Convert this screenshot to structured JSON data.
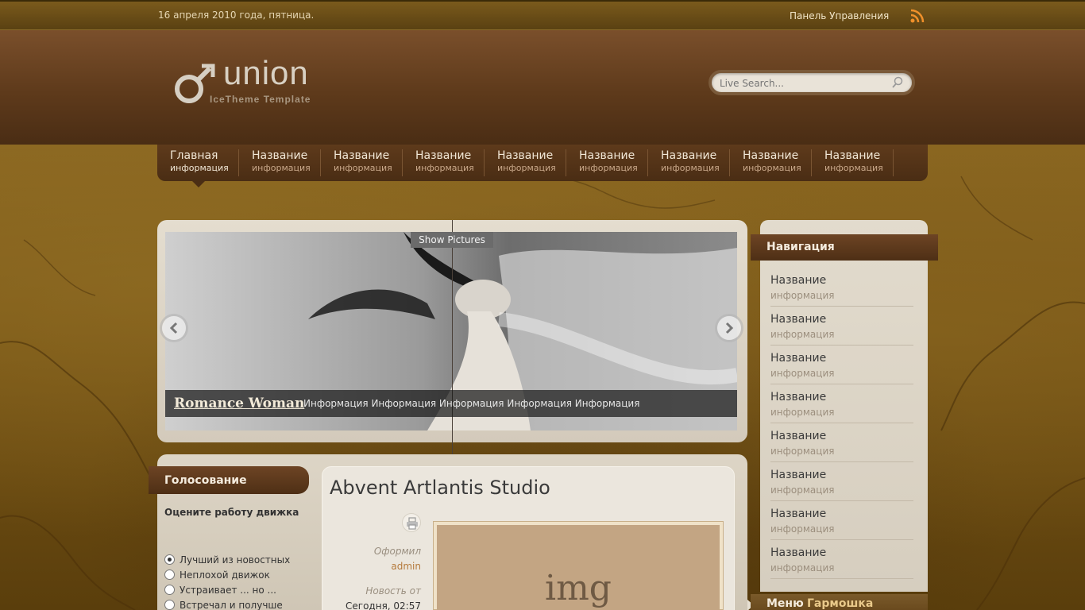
{
  "topbar": {
    "date": "16 апреля 2010 года, пятница.",
    "panel_label": "Панель Управления",
    "rss_icon": "rss-icon"
  },
  "header": {
    "logo_text": "union",
    "logo_sub": "IceTheme Template",
    "search_placeholder": "Live Search..."
  },
  "nav": {
    "items": [
      {
        "title": "Главная",
        "sub": "информация"
      },
      {
        "title": "Название",
        "sub": "информация"
      },
      {
        "title": "Название",
        "sub": "информация"
      },
      {
        "title": "Название",
        "sub": "информация"
      },
      {
        "title": "Название",
        "sub": "информация"
      },
      {
        "title": "Название",
        "sub": "информация"
      },
      {
        "title": "Название",
        "sub": "информация"
      },
      {
        "title": "Название",
        "sub": "информация"
      },
      {
        "title": "Название",
        "sub": "информация"
      }
    ]
  },
  "slideshow": {
    "show_pictures": "Show Pictures",
    "caption_title": "Romance Woman",
    "caption_desc": "Информация Информация Информация Информация Информация"
  },
  "poll": {
    "title": "Голосование",
    "question": "Оцените работу движка",
    "options": [
      "Лучший из новостных",
      "Неплохой движок",
      "Устраивает ... но ...",
      "Встречал и получше"
    ]
  },
  "article": {
    "title": "Abvent Artlantis Studio",
    "author_label": "Оформил",
    "author": "admin",
    "date_label": "Новость от",
    "date": "Сегодня, 02:57",
    "image_label": "img"
  },
  "sidebar": {
    "title": "Навигация",
    "items": [
      {
        "title": "Название",
        "sub": "информация"
      },
      {
        "title": "Название",
        "sub": "информация"
      },
      {
        "title": "Название",
        "sub": "информация"
      },
      {
        "title": "Название",
        "sub": "информация"
      },
      {
        "title": "Название",
        "sub": "информация"
      },
      {
        "title": "Название",
        "sub": "информация"
      },
      {
        "title": "Название",
        "sub": "информация"
      },
      {
        "title": "Название",
        "sub": "информация"
      }
    ],
    "menu_title_a": "Меню",
    "menu_title_b": "Гармошка"
  }
}
